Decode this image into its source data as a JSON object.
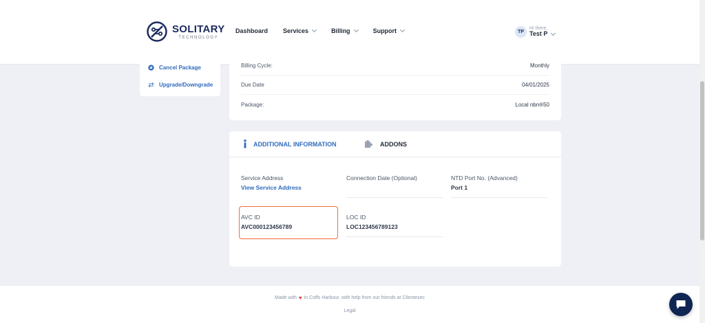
{
  "brand": {
    "name": "SOLITARY",
    "tagline": "TECHNOLOGY",
    "color": "#1b2a5e"
  },
  "nav": {
    "items": [
      {
        "label": "Dashboard",
        "dropdown": false
      },
      {
        "label": "Services",
        "dropdown": true
      },
      {
        "label": "Billing",
        "dropdown": true
      },
      {
        "label": "Support",
        "dropdown": true
      }
    ]
  },
  "user": {
    "initials": "TP",
    "greeting": "Hi there,",
    "name": "Test P"
  },
  "sidebar": {
    "cancel_label": "Cancel Package",
    "cancel_icon": "x-circle-icon",
    "upgrade_label": "Upgrade/Downgrade",
    "upgrade_icon": "swap-arrows-icon"
  },
  "service_info": {
    "billing_cycle_label": "Billing Cycle:",
    "billing_cycle_value": "Monthly",
    "due_date_label": "Due Date",
    "due_date_value": "04/01/2025",
    "package_label": "Package:",
    "package_value": "Local nbn®50"
  },
  "tabs": {
    "info_label": "ADDITIONAL INFORMATION",
    "info_icon": "info-icon",
    "addons_label": "ADDONS",
    "addons_icon": "puzzle-icon",
    "accent": "#2f6bbd"
  },
  "fields": {
    "service_address_label": "Service Address",
    "service_address_link": "View Service Address",
    "connection_date_label": "Connection Date (Optional)",
    "ntd_port_label": "NTD Port No. (Advanced)",
    "ntd_port_value": "Port 1",
    "avc_id_label": "AVC ID",
    "avc_id_value": "AVC000123456789",
    "loc_id_label": "LOC ID",
    "loc_id_value": "LOC123456789123",
    "highlight_color": "#f26b3a"
  },
  "footer": {
    "text_before": "Made with",
    "text_after": "in Coffs Harbour, with help from our friends at Clientexec",
    "legal": "Legal"
  },
  "chat": {
    "icon": "chat-bubble-icon"
  }
}
